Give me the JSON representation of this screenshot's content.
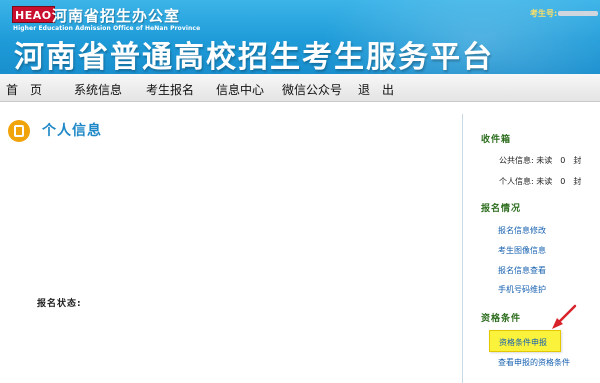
{
  "header": {
    "logo": "HEAO",
    "office_name": "河南省招生办公室",
    "office_name_en": "Higher Education Admission Office of HeNan Province",
    "platform_title": "河南省普通高校招生考生服务平台",
    "exam_no_label": "考生号:"
  },
  "nav": {
    "items": [
      "首　页",
      "系统信息",
      "考生报名",
      "信息中心",
      "微信公众号",
      "退　出"
    ]
  },
  "main": {
    "title": "个人信息",
    "status_label": "报名状态:"
  },
  "sidebar": {
    "inbox": {
      "title": "收件箱",
      "public": "公共信息: 未读　0　封",
      "personal": "个人信息: 未读　0　封"
    },
    "registration": {
      "title": "报名情况",
      "links": [
        "报名信息修改",
        "考生图像信息",
        "报名信息查看",
        "手机号码维护"
      ]
    },
    "qualification": {
      "title": "资格条件",
      "apply": "资格条件申报",
      "view": "查看申报的资格条件"
    }
  },
  "colors": {
    "banner": "#1e9bd8",
    "highlight": "#fbf23c",
    "arrow": "#d8232a",
    "title": "#1e88c7",
    "section": "#2b6c1c",
    "link": "#1560b0"
  }
}
